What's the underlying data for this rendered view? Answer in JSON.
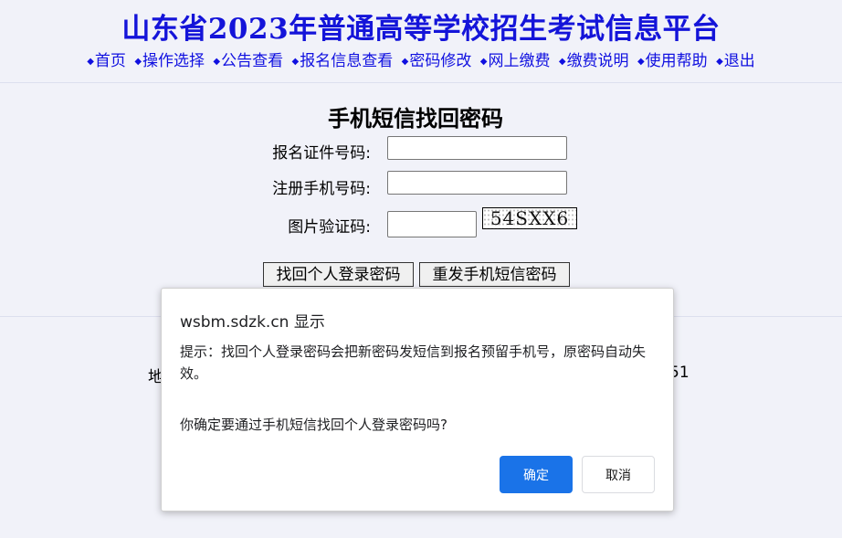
{
  "site_title": "山东省2023年普通高等学校招生考试信息平台",
  "nav": {
    "bullet": "◆",
    "items": [
      "首页",
      "操作选择",
      "公告查看",
      "报名信息查看",
      "密码修改",
      "网上缴费",
      "缴费说明",
      "使用帮助",
      "退出"
    ]
  },
  "form": {
    "title": "手机短信找回密码",
    "id_label": "报名证件号码:",
    "id_value": "",
    "phone_label": "注册手机号码:",
    "phone_value": "",
    "captcha_label": "图片验证码:",
    "captcha_value": "",
    "captcha_image_text": "54SXX6",
    "recover_button": "找回个人登录密码",
    "resend_button": "重发手机短信密码"
  },
  "footer_fragments": {
    "left": "地",
    "right": "51"
  },
  "dialog": {
    "host": "wsbm.sdzk.cn 显示",
    "message": "提示：找回个人登录密码会把新密码发短信到报名预留手机号，原密码自动失效。",
    "question": "你确定要通过手机短信找回个人登录密码吗?",
    "ok": "确定",
    "cancel": "取消"
  }
}
